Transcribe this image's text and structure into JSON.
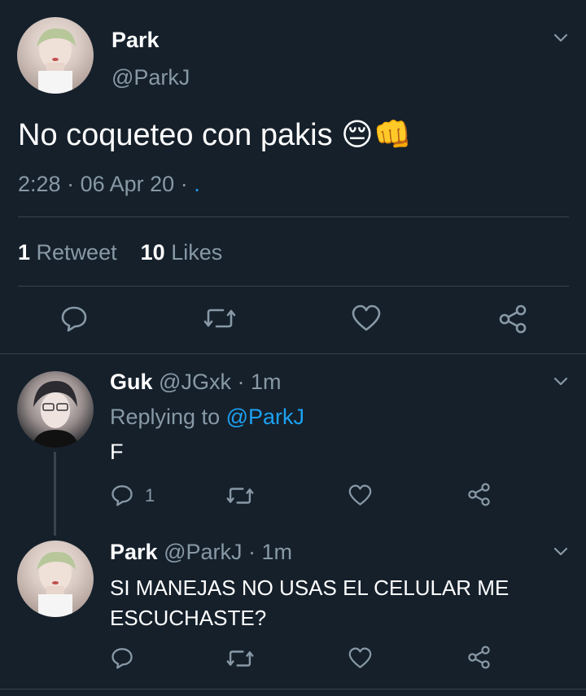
{
  "main_tweet": {
    "name": "Park",
    "handle": "@ParkJ",
    "text": "No coqueteo con pakis 😔👊",
    "time": "2:28",
    "date": "06 Apr 20",
    "sep": "·",
    "source": ".",
    "retweet_count": "1",
    "retweet_label": "Retweet",
    "like_count": "10",
    "like_label": "Likes"
  },
  "replies": [
    {
      "name": "Guk",
      "handle": "@JGxk",
      "time": "· 1m",
      "replying_label": "Replying to",
      "replying_to": "@ParkJ",
      "text": "F",
      "reply_count": "1"
    },
    {
      "name": "Park",
      "handle": "@ParkJ",
      "time": "· 1m",
      "text_line1": "SI MANEJAS NO USAS EL CELULAR ME",
      "text_line2": "ESCUCHASTE?"
    }
  ],
  "colors": {
    "background": "#15202b",
    "muted": "#8899a6",
    "accent": "#1da1f2",
    "divider": "#38444d"
  },
  "icons": [
    "chevron-down-icon",
    "reply-icon",
    "retweet-icon",
    "heart-icon",
    "share-icon"
  ]
}
